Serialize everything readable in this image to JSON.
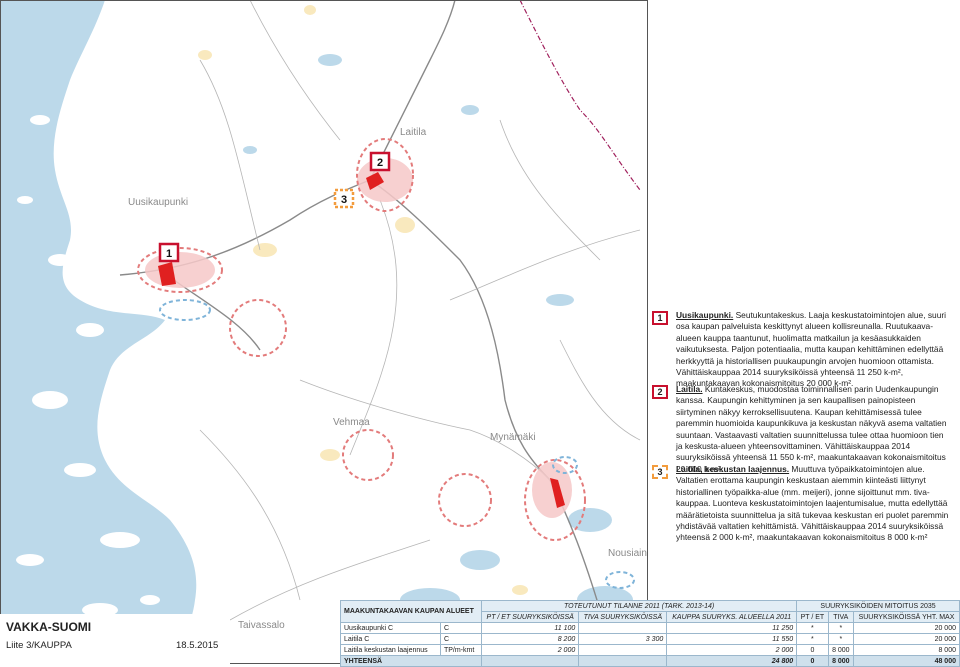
{
  "map": {
    "places": [
      {
        "name": "Uusikaupunki",
        "key": "uusikaupunki"
      },
      {
        "name": "Laitila",
        "key": "laitila"
      },
      {
        "name": "Vehmaa",
        "key": "vehmaa"
      },
      {
        "name": "Mynämäki",
        "key": "mynamaki"
      },
      {
        "name": "Nousiainen",
        "key": "nousiainen"
      },
      {
        "name": "Taivassalo",
        "key": "taivassalo"
      }
    ],
    "markers": [
      "1",
      "2",
      "3"
    ],
    "colors": {
      "water": "#bcd9ea",
      "land": "#ffffff",
      "road": "#8a8a8a",
      "urban": "#f6c8c8",
      "center": "#e02020",
      "ring": "#e37b7b",
      "blue_ring": "#7fb4d9",
      "border": "#a0205c",
      "orange": "#f39c3d",
      "yellow": "#f7dfa3"
    }
  },
  "legend": [
    {
      "num": "1",
      "title": "Uusikaupunki.",
      "text": " Seutukuntakeskus. Laaja keskustatoimintojen alue, suuri osa kaupan palveluista keskittynyt alueen kollisreunalla. Ruutukaava-alueen kauppa taantunut, huolimatta matkailun ja kesäasukkaiden vaikutuksesta. Paljon potentiaalia, mutta kaupan kehittäminen edellyttää herkkyyttä ja historiallisen puukaupungin arvojen huomioon ottamista. Vähittäiskauppaa 2014 suuryksiköissä yhteensä 11 250 k-m², maakuntakaavan kokonaismitoitus 20 000 k-m²."
    },
    {
      "num": "2",
      "title": "Laitila.",
      "text": " Kuntakeskus, muodostaa toiminnallisen parin Uudenkaupungin kanssa. Kaupungin kehittyminen ja sen kaupallisen painopisteen siirtyminen näkyy kerroksellisuutena. Kaupan kehittämisessä tulee paremmin huomioida kaupunkikuva ja keskustan näkyvä asema valtatien suuntaan. Vastaavasti valtatien suunnittelussa tulee ottaa huomioon tien ja keskusta-alueen yhteensovittaminen. Vähittäiskauppaa 2014 suuryksiköissä yhteensä 11 550 k-m², maakuntakaavan kokonaismitoitus 20 000 k-m²."
    },
    {
      "num": "3",
      "title": "Laitila, keskustan laajennus.",
      "text": " Muuttuva työpaikkatoimintojen alue. Valtatien erottama kaupungin keskustaan aiemmin kiinteästi liittynyt historiallinen työpaikka-alue (mm. meijeri), jonne sijoittunut mm. tiva-kauppaa. Luonteva keskustatoimintojen laajentumisalue, mutta edellyttää määrätietoista suunnittelua ja sitä tukevaa keskustan eri puolet paremmin yhdistävää valtatien kehittämistä. Vähittäiskauppaa 2014 suuryksiköissä yhteensä 2 000 k-m², maakuntakaavan kokonaismitoitus 8 000 k-m²"
    }
  ],
  "title_block": {
    "title": "VAKKA-SUOMI",
    "subtitle": "Liite 3/KAUPPA",
    "date": "18.5.2015"
  },
  "table": {
    "group1": "TOTEUTUNUT TILANNE 2011 (TARK. 2013-14)",
    "group2": "SUURYKSIKÖIDEN MITOITUS 2035",
    "col_area": "MAAKUNTAKAAVAN KAUPAN ALUEET",
    "col_pt": "PT / ET SUURYKSIKÖISSÄ",
    "col_tiva": "TIVA SUURYKSIKÖISSÄ",
    "col_kauppa": "KAUPPA SUURYKS. ALUEELLA 2011",
    "col_pt2": "PT / ET",
    "col_tiva2": "TIVA",
    "col_max": "SUURYKSIKÖISSÄ YHT. MAX",
    "rows": [
      {
        "name": "Uusikaupunki C",
        "code": "C",
        "pt": "11 100",
        "tiva": "",
        "kauppa": "11 250",
        "pt2": "*",
        "tiva2": "*",
        "max": "20 000"
      },
      {
        "name": "Laitila C",
        "code": "C",
        "pt": "8 200",
        "tiva": "3 300",
        "kauppa": "11 550",
        "pt2": "*",
        "tiva2": "*",
        "max": "20 000"
      },
      {
        "name": "Laitila keskustan laajennus",
        "code": "TP/m-kmt",
        "pt": "2 000",
        "tiva": "",
        "kauppa": "2 000",
        "pt2": "0",
        "tiva2": "8 000",
        "max": "8 000"
      }
    ],
    "total": {
      "name": "YHTEENSÄ",
      "pt": "",
      "tiva": "",
      "kauppa": "24 800",
      "pt2": "0",
      "tiva2": "8 000",
      "max": "48 000"
    }
  }
}
